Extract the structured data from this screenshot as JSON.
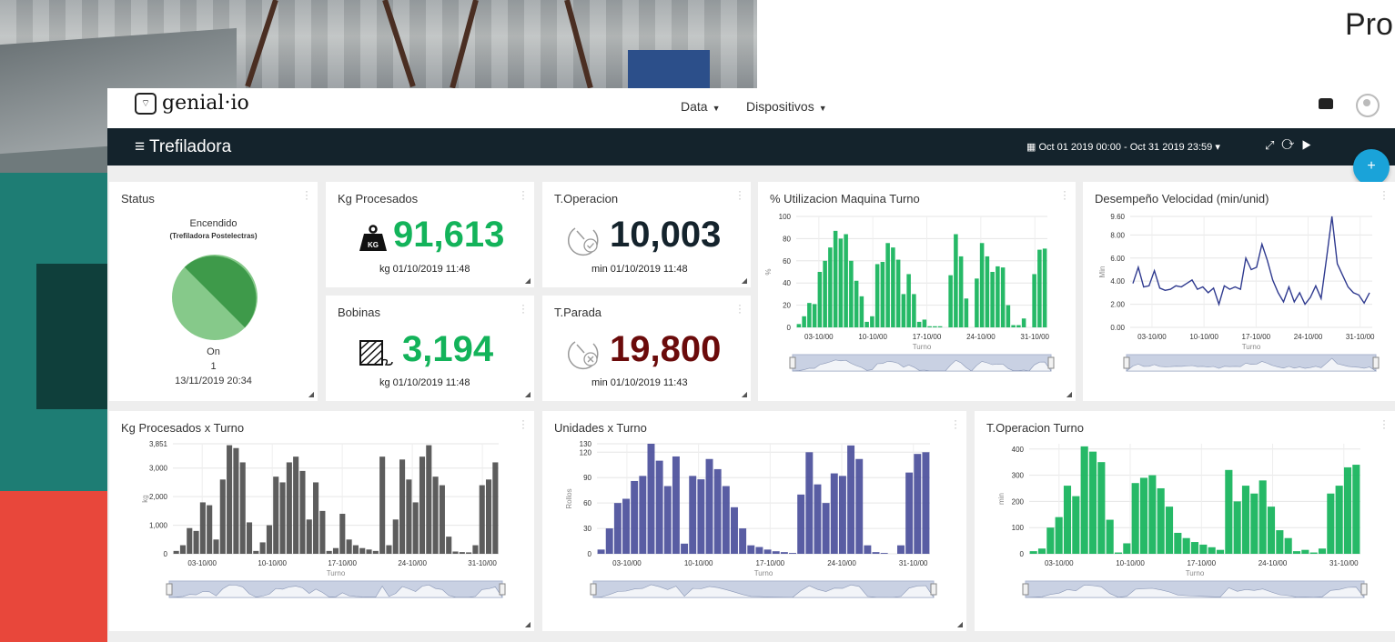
{
  "background": {
    "corner_text": "Pro"
  },
  "topbar": {
    "logo_text": "genial·io",
    "nav": [
      {
        "label": "Data"
      },
      {
        "label": "Dispositivos"
      }
    ]
  },
  "titlebar": {
    "title": "≡ Trefiladora",
    "date_range": "Oct 01 2019 00:00 - Oct 31 2019 23:59",
    "fab": "+"
  },
  "panels": {
    "status": {
      "title": "Status",
      "state": "Encendido",
      "device": "(Trefiladora Postelectras)",
      "value_label": "On",
      "value": "1",
      "timestamp": "13/11/2019 20:34"
    },
    "kg": {
      "title": "Kg Procesados",
      "value": "91,613",
      "sub": "kg 01/10/2019 11:48",
      "icon_label": "KG"
    },
    "toper": {
      "title": "T.Operacion",
      "value": "10,003",
      "sub": "min 01/10/2019 11:48"
    },
    "bobinas": {
      "title": "Bobinas",
      "value": "3,194",
      "sub": "kg 01/10/2019 11:48"
    },
    "tparada": {
      "title": "T.Parada",
      "value": "19,800",
      "sub": "min 01/10/2019 11:43"
    },
    "util": {
      "title": "% Utilizacion Maquina Turno"
    },
    "desemp": {
      "title": "Desempeño Velocidad (min/unid)"
    },
    "kgturno": {
      "title": "Kg Procesados x Turno"
    },
    "unidades": {
      "title": "Unidades x Turno"
    },
    "toperturno": {
      "title": "T.Operacion Turno"
    }
  },
  "colors": {
    "green": "#13b35a",
    "dark": "#14232c",
    "maroon": "#6b0b0b",
    "gray_bar": "#4f4f4f",
    "blue_bar": "#4b4f9b",
    "line": "#2f3a8f",
    "pie_dark": "#3e9a4a",
    "pie_light": "#86c98a"
  },
  "chart_data": [
    {
      "type": "bar",
      "title": "% Utilizacion Maquina Turno",
      "xlabel": "Turno",
      "ylabel": "%",
      "ylim": [
        0,
        100
      ],
      "yticks": [
        "0",
        "20",
        "40",
        "60",
        "80",
        "100"
      ],
      "xticks": [
        "03-10/00",
        "10-10/00",
        "17-10/00",
        "24-10/00",
        "31-10/00"
      ],
      "values": [
        3,
        10,
        22,
        21,
        50,
        60,
        72,
        87,
        80,
        84,
        60,
        42,
        28,
        5,
        10,
        57,
        59,
        76,
        72,
        61,
        30,
        48,
        30,
        5,
        7,
        1,
        1,
        1,
        0,
        47,
        84,
        64,
        26,
        0,
        44,
        76,
        64,
        50,
        55,
        54,
        20,
        2,
        2,
        8,
        0,
        48,
        70,
        71
      ]
    },
    {
      "type": "line",
      "title": "Desempeño Velocidad (min/unid)",
      "xlabel": "Turno",
      "ylabel": "Min",
      "ylim": [
        0,
        9.6
      ],
      "yticks": [
        "0.00",
        "2.00",
        "4.00",
        "6.00",
        "8.00",
        "9.60"
      ],
      "xticks": [
        "03-10/00",
        "10-10/00",
        "17-10/00",
        "24-10/00",
        "31-10/00"
      ],
      "values": [
        3.8,
        5.2,
        3.5,
        3.6,
        4.9,
        3.4,
        3.2,
        3.3,
        3.6,
        3.5,
        3.8,
        4.1,
        3.3,
        3.5,
        3.0,
        3.4,
        2.0,
        3.6,
        3.3,
        3.5,
        3.3,
        6.0,
        5.0,
        5.2,
        7.2,
        5.8,
        4.1,
        3.0,
        2.2,
        3.5,
        2.2,
        3.0,
        2.0,
        2.6,
        3.6,
        2.5,
        6.0,
        9.6,
        5.5,
        4.5,
        3.5,
        3.0,
        2.8,
        2.1,
        3.0
      ]
    },
    {
      "type": "bar",
      "title": "Kg Procesados x Turno",
      "xlabel": "Turno",
      "ylabel": "kg",
      "ylim": [
        0,
        3851
      ],
      "yticks": [
        "0",
        "1,000",
        "2,000",
        "3,000",
        "3,851"
      ],
      "xticks": [
        "03-10/00",
        "10-10/00",
        "17-10/00",
        "24-10/00",
        "31-10/00"
      ],
      "values": [
        100,
        300,
        900,
        800,
        1800,
        1700,
        500,
        2600,
        3800,
        3700,
        3200,
        1100,
        100,
        400,
        1000,
        2700,
        2500,
        3200,
        3400,
        2900,
        1200,
        2500,
        1500,
        100,
        200,
        1400,
        500,
        300,
        200,
        150,
        100,
        3400,
        300,
        1200,
        3300,
        2600,
        1800,
        3400,
        3800,
        2700,
        2400,
        600,
        80,
        60,
        50,
        300,
        2400,
        2600,
        3200
      ]
    },
    {
      "type": "bar",
      "title": "Unidades x Turno",
      "xlabel": "Turno",
      "ylabel": "Rollos",
      "ylim": [
        0,
        130
      ],
      "yticks": [
        "0",
        "30",
        "60",
        "90",
        "120",
        "130"
      ],
      "xticks": [
        "03-10/00",
        "10-10/00",
        "17-10/00",
        "24-10/00",
        "31-10/00"
      ],
      "values": [
        5,
        30,
        60,
        65,
        86,
        92,
        130,
        110,
        80,
        115,
        12,
        92,
        88,
        112,
        100,
        80,
        55,
        30,
        10,
        8,
        5,
        3,
        2,
        1,
        70,
        120,
        82,
        60,
        95,
        92,
        128,
        112,
        10,
        2,
        1,
        0,
        10,
        96,
        118,
        120
      ]
    },
    {
      "type": "bar",
      "title": "T.Operacion Turno",
      "xlabel": "Turno",
      "ylabel": "min",
      "ylim": [
        0,
        420
      ],
      "yticks": [
        "0",
        "100",
        "200",
        "300",
        "400"
      ],
      "xticks": [
        "03-10/00",
        "10-10/00",
        "17-10/00",
        "24-10/00",
        "31-10/00"
      ],
      "values": [
        10,
        20,
        100,
        140,
        260,
        220,
        410,
        390,
        350,
        130,
        5,
        40,
        270,
        290,
        300,
        250,
        180,
        80,
        60,
        45,
        35,
        25,
        15,
        320,
        200,
        260,
        230,
        280,
        180,
        90,
        60,
        10,
        15,
        5,
        20,
        230,
        260,
        330,
        340
      ]
    }
  ]
}
